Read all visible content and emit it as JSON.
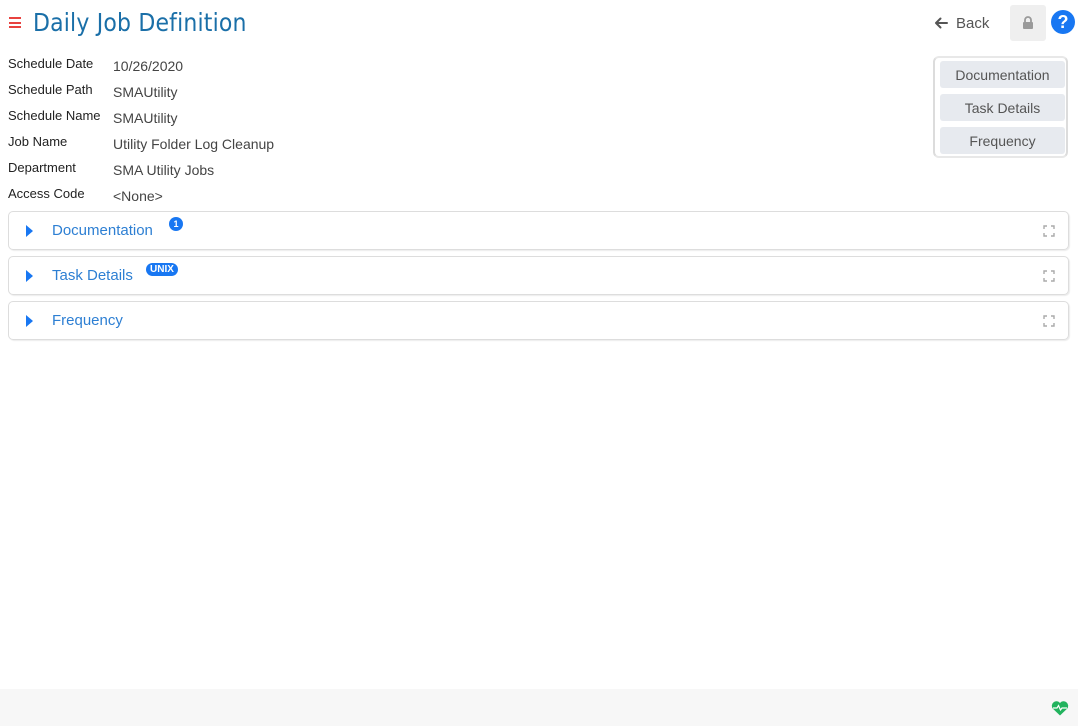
{
  "header": {
    "title": "Daily Job Definition",
    "back_label": "Back",
    "lock_icon": "lock-icon",
    "help_icon": "question-circle-icon",
    "help_glyph": "?"
  },
  "properties": [
    {
      "label": "Schedule Date",
      "value": "10/26/2020"
    },
    {
      "label": "Schedule Path",
      "value": "SMAUtility"
    },
    {
      "label": "Schedule Name",
      "value": "SMAUtility"
    },
    {
      "label": "Job Name",
      "value": "Utility Folder Log Cleanup"
    },
    {
      "label": "Department",
      "value": "SMA Utility Jobs"
    },
    {
      "label": "Access Code",
      "value": "<None>"
    }
  ],
  "quicknav": [
    "Documentation",
    "Task Details",
    "Frequency"
  ],
  "sections": [
    {
      "title": "Documentation",
      "badge": "1"
    },
    {
      "title": "Task Details",
      "badge": "UNIX"
    },
    {
      "title": "Frequency"
    }
  ],
  "footer": {
    "status_icon": "heartbeat-icon",
    "status_color": "#22b35e"
  },
  "colors": {
    "accent": "#1877f2",
    "title": "#1a6fa8",
    "menu": "#e8423f"
  }
}
